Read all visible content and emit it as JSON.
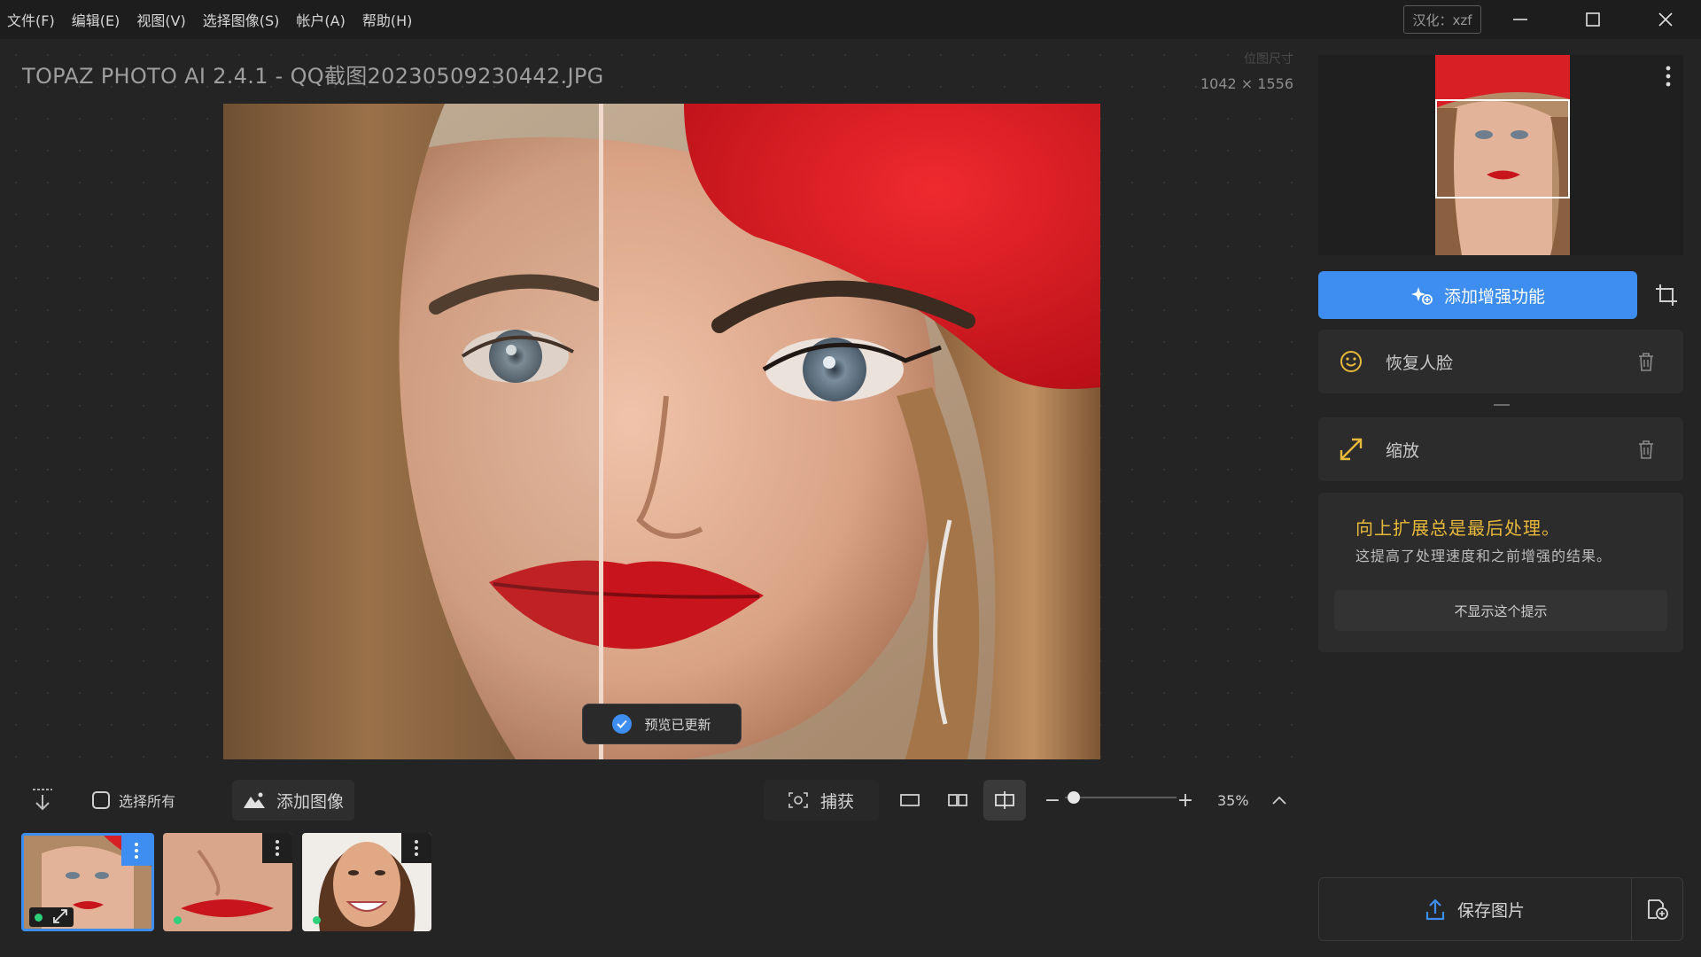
{
  "menu": [
    {
      "label": "文件(F)"
    },
    {
      "label": "编辑(E)"
    },
    {
      "label": "视图(V)"
    },
    {
      "label": "选择图像(S)"
    },
    {
      "label": "帐户(A)"
    },
    {
      "label": "帮助(H)"
    }
  ],
  "badge": "汉化：xzf",
  "window": {
    "minimize_icon": "minimize-icon",
    "maximize_icon": "maximize-icon",
    "close_icon": "close-icon"
  },
  "document": {
    "title": "TOPAZ PHOTO AI 2.4.1 - QQ截图20230509230442.JPG",
    "dimensions_label": "位图尺寸",
    "dimensions_value": "1042 × 1556"
  },
  "preview": {
    "toast": "预览已更新",
    "toast_icon": "check-circle-icon"
  },
  "toolbar": {
    "import_icon": "download-icon",
    "select_all": "选择所有",
    "add_image": "添加图像",
    "capture": "捕获",
    "view_single_icon": "single-view-icon",
    "view_side_icon": "side-by-side-icon",
    "view_split_icon": "split-view-icon",
    "zoom_out": "−",
    "zoom_in": "+",
    "zoom_value": 0.35,
    "zoom": "35%"
  },
  "thumbnails": [
    {
      "name": "thumbnail-1",
      "selected": true
    },
    {
      "name": "thumbnail-2",
      "selected": false
    },
    {
      "name": "thumbnail-3",
      "selected": false
    }
  ],
  "panel": {
    "add_enhancement": "添加增强功能",
    "enhancements": [
      {
        "label": "恢复人脸",
        "icon": "face-icon"
      },
      {
        "label": "缩放",
        "icon": "resize-arrows-icon"
      }
    ],
    "tip_title": "向上扩展总是最后处理。",
    "tip_body": "这提高了处理速度和之前增强的结果。",
    "tip_button": "不显示这个提示",
    "save": "保存图片"
  },
  "colors": {
    "accent": "#3e8df0",
    "tip": "#e8b93a",
    "status_green": "#2fd07a"
  }
}
